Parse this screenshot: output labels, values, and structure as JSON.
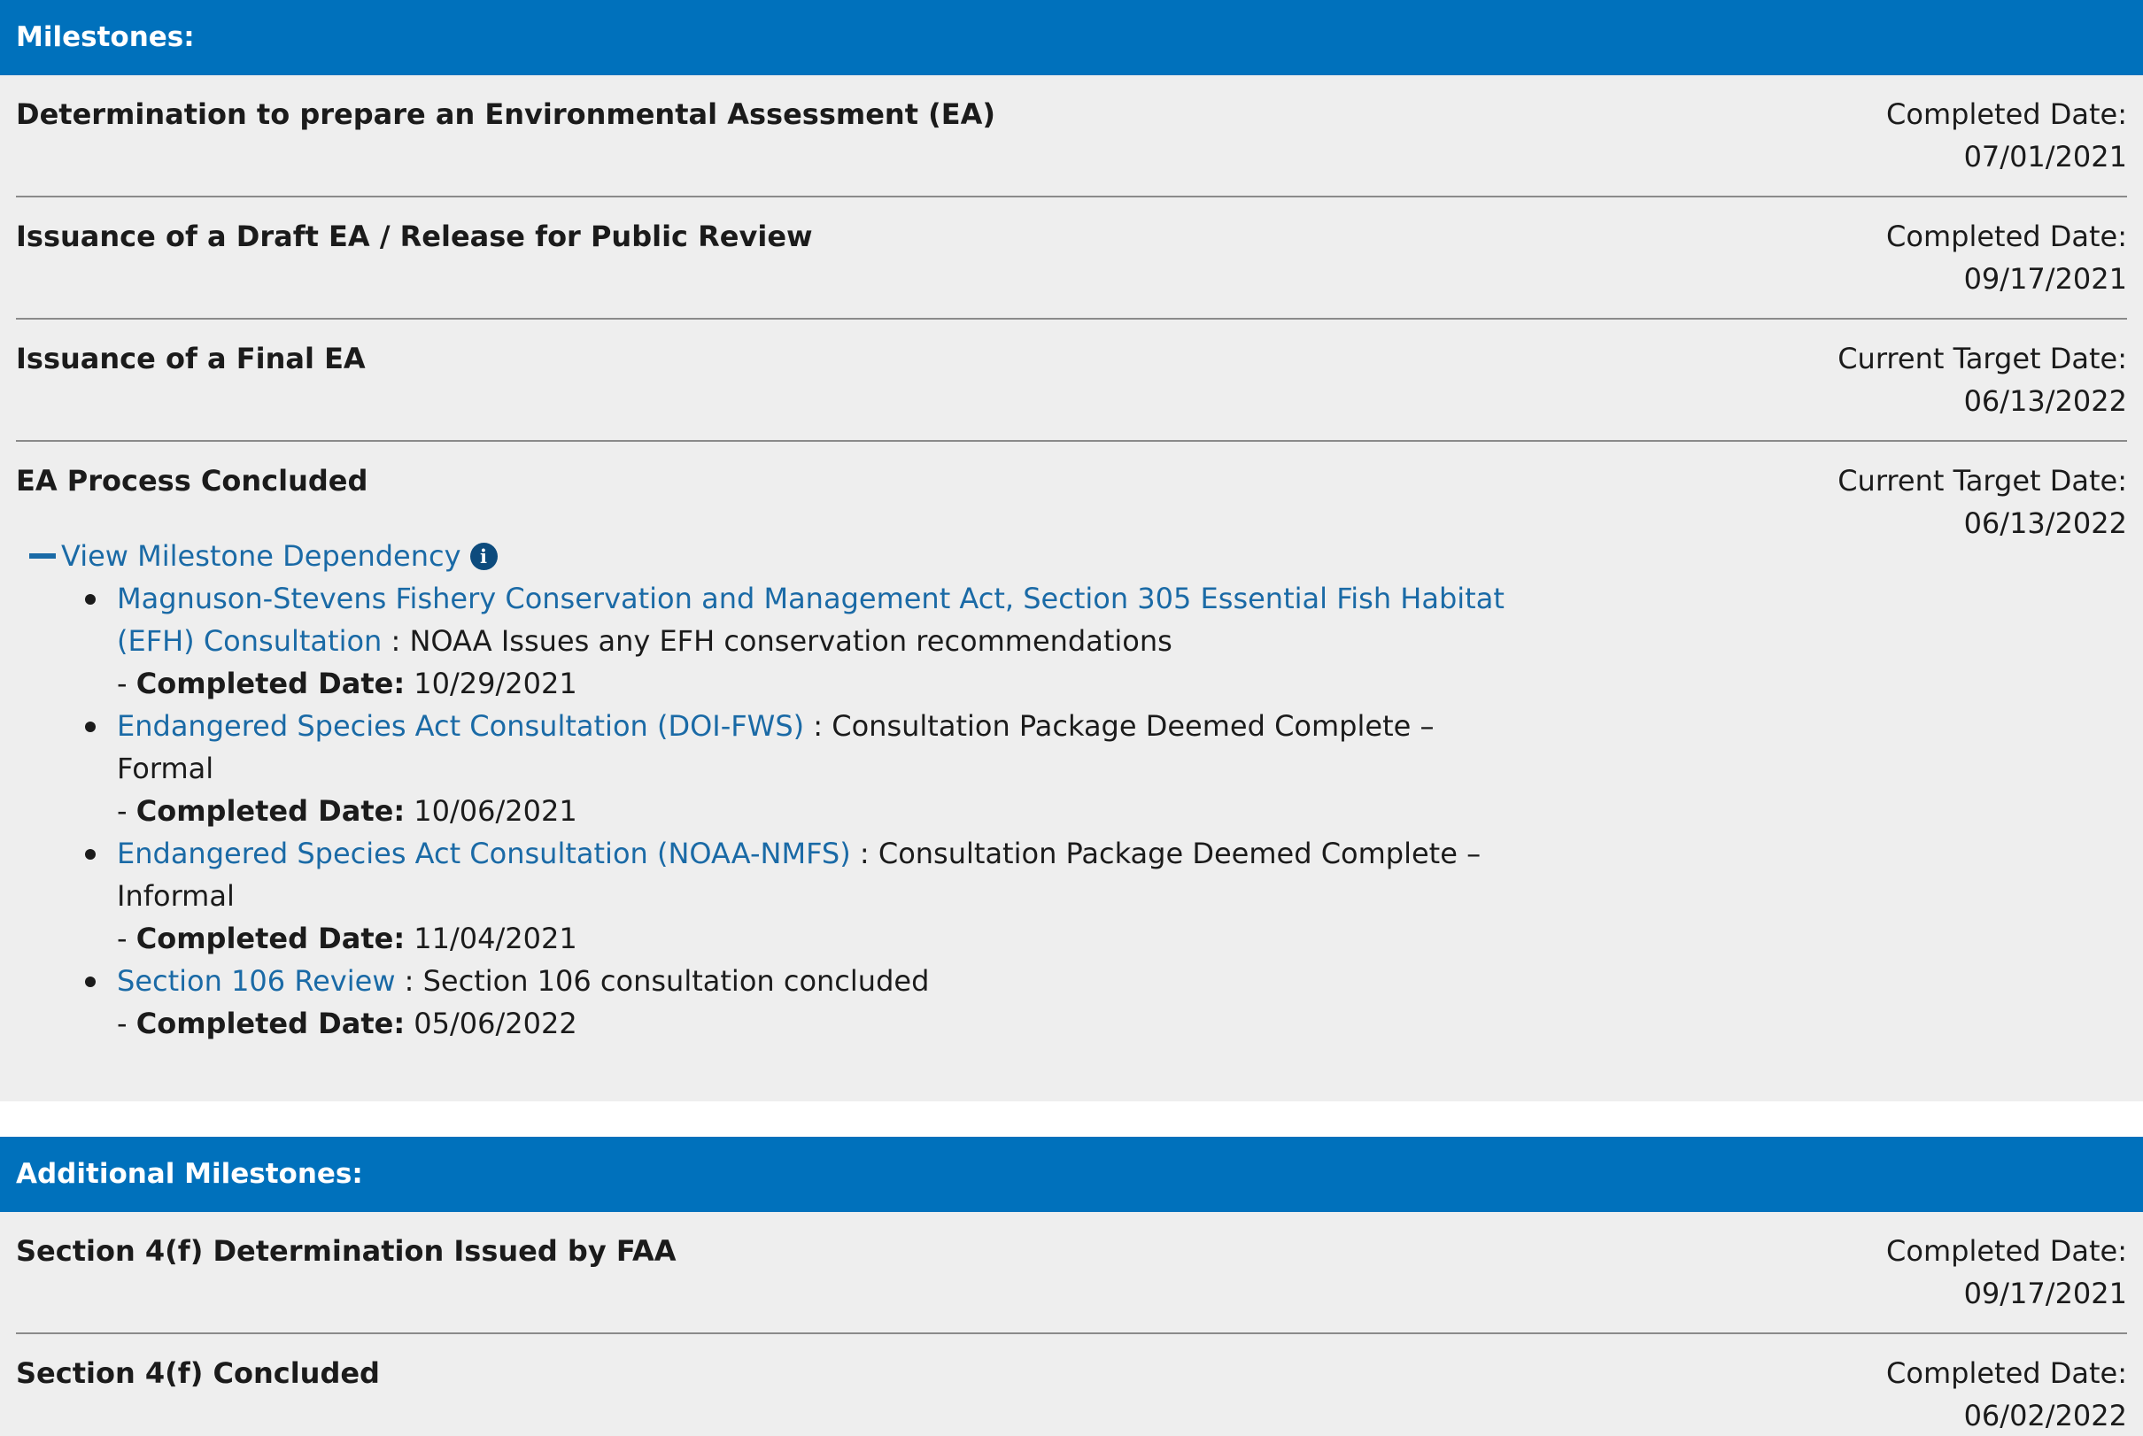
{
  "milestones": {
    "header": "Milestones:",
    "items": [
      {
        "title": "Determination to prepare an Environmental Assessment (EA)",
        "date_label": "Completed Date:",
        "date": "07/01/2021"
      },
      {
        "title": "Issuance of a Draft EA / Release for Public Review",
        "date_label": "Completed Date:",
        "date": "09/17/2021"
      },
      {
        "title": "Issuance of a Final EA",
        "date_label": "Current Target Date:",
        "date": "06/13/2022"
      },
      {
        "title": "EA Process Concluded",
        "date_label": "Current Target Date:",
        "date": "06/13/2022"
      }
    ],
    "dependency": {
      "toggle_label": "View Milestone Dependency",
      "info_icon": "i",
      "completed_prefix": "- ",
      "completed_label": "Completed Date:",
      "items": [
        {
          "link": "Magnuson-Stevens Fishery Conservation and Management Act, Section 305 Essential Fish Habitat (EFH) Consultation",
          "desc": " : NOAA Issues any EFH conservation recommendations",
          "date": "10/29/2021"
        },
        {
          "link": "Endangered Species Act Consultation (DOI-FWS)",
          "desc": " : Consultation Package Deemed Complete – Formal",
          "date": "10/06/2021"
        },
        {
          "link": "Endangered Species Act Consultation (NOAA-NMFS)",
          "desc": " : Consultation Package Deemed Complete – Informal",
          "date": "11/04/2021"
        },
        {
          "link": "Section 106 Review",
          "desc": " : Section 106 consultation concluded",
          "date": "05/06/2022"
        }
      ]
    }
  },
  "additional_milestones": {
    "header": "Additional Milestones:",
    "items": [
      {
        "title": "Section 4(f) Determination Issued by FAA",
        "date_label": "Completed Date:",
        "date": "09/17/2021"
      },
      {
        "title": "Section 4(f) Concluded",
        "date_label": "Completed Date:",
        "date": "06/02/2022"
      }
    ]
  },
  "colors": {
    "header_bg": "#0071bc",
    "body_bg": "#eeeeee",
    "link": "#1a6aa6"
  }
}
